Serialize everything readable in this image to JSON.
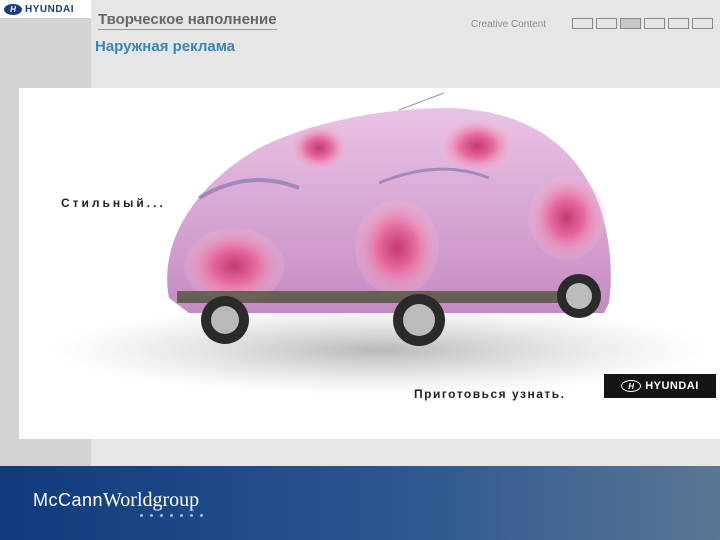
{
  "header": {
    "logo_text": "HYUNDAI",
    "logo_mark": "H",
    "title": "Творческое наполнение",
    "subtitle": "Наружная реклама",
    "section_label": "Creative Content",
    "progress": {
      "total": 6,
      "active_index": 2
    }
  },
  "ad": {
    "tagline_top": "Стильный...",
    "tagline_bottom": "Приготовься узнать.",
    "logo_text": "HYUNDAI",
    "logo_mark": "H",
    "image": "car-covered-in-floral-fabric"
  },
  "footer": {
    "brand_prefix": "McCann",
    "brand_suffix": "Worldgroup",
    "dot_count": 7
  },
  "colors": {
    "background": "#e6e6e6",
    "left_band": "#d3d3d3",
    "subtitle_blue": "#3a86b4",
    "footer_blue": "#0f3b7d",
    "hyundai_blue": "#1d3d7a"
  }
}
